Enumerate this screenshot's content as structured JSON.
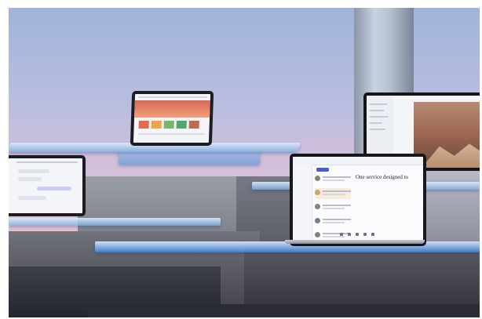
{
  "scene": {
    "description_visible": "Marketing photo of laptops on glass plates and concrete blocks",
    "front_laptop": {
      "document_heading": "One service designed to"
    }
  },
  "colors": {
    "sky_top": "#9fb4da",
    "sky_bottom": "#e8c6d4",
    "glass": "#78aadc",
    "accent": "#4b5bd4"
  }
}
